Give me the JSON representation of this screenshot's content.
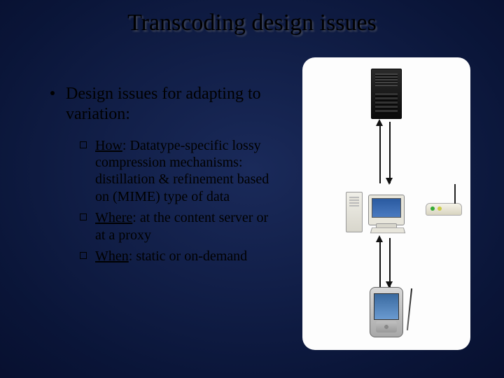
{
  "title": "Transcoding design issues",
  "main_bullet": "Design issues for adapting to variation:",
  "subs": [
    {
      "lead": "How",
      "rest": ": Datatype-specific lossy compression mechanisms: distillation & refinement based on (MIME) type of data"
    },
    {
      "lead": "Where",
      "rest": ": at the content server or at a proxy"
    },
    {
      "lead": "When",
      "rest": ": static or on-demand"
    }
  ]
}
